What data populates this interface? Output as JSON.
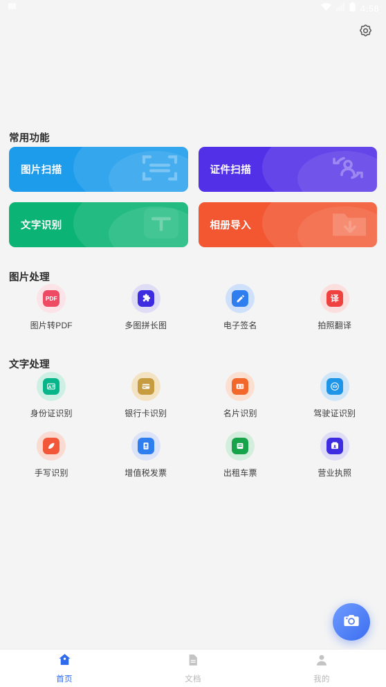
{
  "statusbar": {
    "time": "4:58",
    "notification_icon": "message-icon",
    "wifi_icon": "wifi-icon",
    "signal_icon": "signal-icon",
    "battery_icon": "battery-icon"
  },
  "header": {
    "settings_icon": "gear-icon"
  },
  "sections": {
    "common": {
      "title": "常用功能",
      "cards": [
        {
          "label": "图片扫描",
          "color": "#1e9cec",
          "class": "c-blue",
          "watermark": "document-scan-icon"
        },
        {
          "label": "证件扫描",
          "color": "#5230e8",
          "class": "c-purple",
          "watermark": "id-person-rotate-icon"
        },
        {
          "label": "文字识别",
          "color": "#0bb474",
          "class": "c-green",
          "watermark": "text-t-icon"
        },
        {
          "label": "相册导入",
          "color": "#f25731",
          "class": "c-orange",
          "watermark": "folder-download-icon"
        }
      ]
    },
    "image": {
      "title": "图片处理",
      "items": [
        {
          "label": "图片转PDF",
          "icon": "pdf-icon",
          "glyph": "PDF",
          "glyph_type": "text",
          "badge": "#ef4a63",
          "halo": "#fbe3e7"
        },
        {
          "label": "多图拼长图",
          "icon": "puzzle-icon",
          "glyph": "",
          "glyph_type": "svg",
          "badge": "#3d2ce0",
          "halo": "#dfdcf6"
        },
        {
          "label": "电子签名",
          "icon": "pencil-sign-icon",
          "glyph": "",
          "glyph_type": "svg",
          "badge": "#2f7ef0",
          "halo": "#cfe0fa"
        },
        {
          "label": "拍照翻译",
          "icon": "translate-icon",
          "glyph": "译",
          "glyph_type": "cjk",
          "badge": "#f04141",
          "halo": "#fbdede"
        }
      ]
    },
    "text": {
      "title": "文字处理",
      "items": [
        {
          "label": "身份证识别",
          "icon": "id-card-icon",
          "glyph": "",
          "glyph_type": "svg",
          "badge": "#06b58a",
          "halo": "#cdf0e4"
        },
        {
          "label": "银行卡识别",
          "icon": "bank-card-icon",
          "glyph": "",
          "glyph_type": "svg",
          "badge": "#c79b3f",
          "halo": "#f3e3c2"
        },
        {
          "label": "名片识别",
          "icon": "business-card-icon",
          "glyph": "",
          "glyph_type": "svg",
          "badge": "#f2672a",
          "halo": "#fbe0d1"
        },
        {
          "label": "驾驶证识别",
          "icon": "drivers-license-icon",
          "glyph": "",
          "glyph_type": "svg",
          "badge": "#1f95e8",
          "halo": "#cfe6f8"
        },
        {
          "label": "手写识别",
          "icon": "handwriting-icon",
          "glyph": "",
          "glyph_type": "svg",
          "badge": "#f2573a",
          "halo": "#fadbd2"
        },
        {
          "label": "增值税发票",
          "icon": "vat-invoice-icon",
          "glyph": "",
          "glyph_type": "svg",
          "badge": "#2f7ef0",
          "halo": "#dbe3f8"
        },
        {
          "label": "出租车票",
          "icon": "taxi-receipt-icon",
          "glyph": "",
          "glyph_type": "svg",
          "badge": "#17a34a",
          "halo": "#d4eedd"
        },
        {
          "label": "营业执照",
          "icon": "business-license-icon",
          "glyph": "",
          "glyph_type": "svg",
          "badge": "#3d2ce0",
          "halo": "#dfdcf6"
        }
      ]
    }
  },
  "fab": {
    "icon": "camera-icon",
    "color": "#3c6ef0"
  },
  "bottomnav": {
    "active_color": "#2f6bed",
    "idle_color": "#b7b7b7",
    "items": [
      {
        "label": "首页",
        "icon": "home-icon",
        "active": true
      },
      {
        "label": "文档",
        "icon": "document-icon",
        "active": false
      },
      {
        "label": "我的",
        "icon": "person-icon",
        "active": false
      }
    ]
  }
}
